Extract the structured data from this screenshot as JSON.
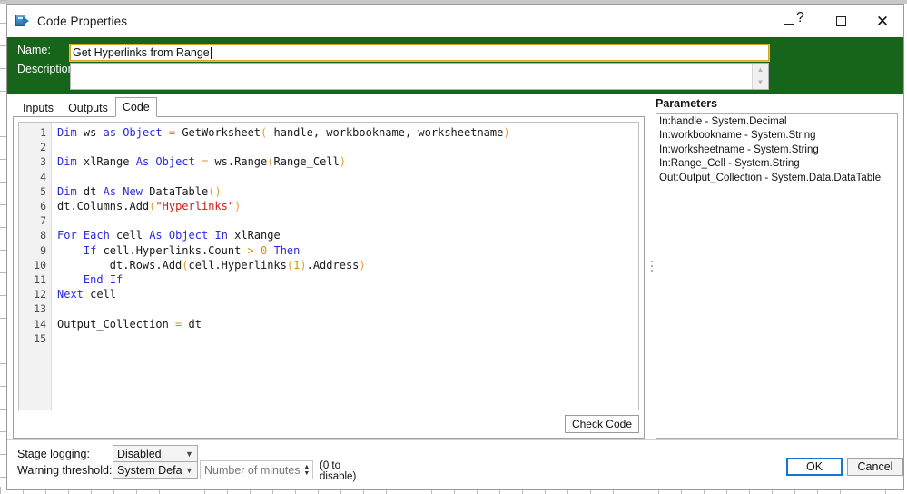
{
  "window": {
    "title": "Code Properties",
    "icon": "code-stage-icon",
    "buttons": {
      "minimize": "—",
      "help": "?",
      "maximize": "□",
      "close": "✕"
    }
  },
  "header": {
    "name_label": "Name:",
    "name_value": "Get Hyperlinks from Range",
    "description_label": "Description:",
    "description_value": "",
    "accent_color": "#16651a",
    "focus_border_color": "#d8a61a"
  },
  "tabs": [
    {
      "label": "Inputs",
      "active": false
    },
    {
      "label": "Outputs",
      "active": false
    },
    {
      "label": "Code",
      "active": true
    }
  ],
  "editor": {
    "line_numbers": [
      "1",
      "2",
      "3",
      "4",
      "5",
      "6",
      "7",
      "8",
      "9",
      "10",
      "11",
      "12",
      "13",
      "14",
      "15"
    ],
    "lines": [
      "Dim ws as Object = GetWorksheet( handle, workbookname, worksheetname)",
      "",
      "Dim xlRange As Object = ws.Range(Range_Cell)",
      "",
      "Dim dt As New DataTable()",
      "dt.Columns.Add(\"Hyperlinks\")",
      "",
      "For Each cell As Object In xlRange",
      "    If cell.Hyperlinks.Count > 0 Then",
      "        dt.Rows.Add(cell.Hyperlinks(1).Address)",
      "    End If",
      "Next cell",
      "",
      "Output_Collection = dt",
      ""
    ],
    "check_code_label": "Check Code"
  },
  "parameters": {
    "title": "Parameters",
    "items": [
      "In:handle - System.Decimal",
      "In:workbookname - System.String",
      "In:worksheetname - System.String",
      "In:Range_Cell - System.String",
      "Out:Output_Collection - System.Data.DataTable"
    ]
  },
  "bottom": {
    "stage_logging_label": "Stage logging:",
    "stage_logging_value": "Disabled",
    "warning_threshold_label": "Warning threshold:",
    "warning_threshold_value": "System Defau",
    "minutes_placeholder": "Number of minutes",
    "hint_line1": "(0 to",
    "hint_line2": "disable)",
    "ok_label": "OK",
    "cancel_label": "Cancel"
  }
}
